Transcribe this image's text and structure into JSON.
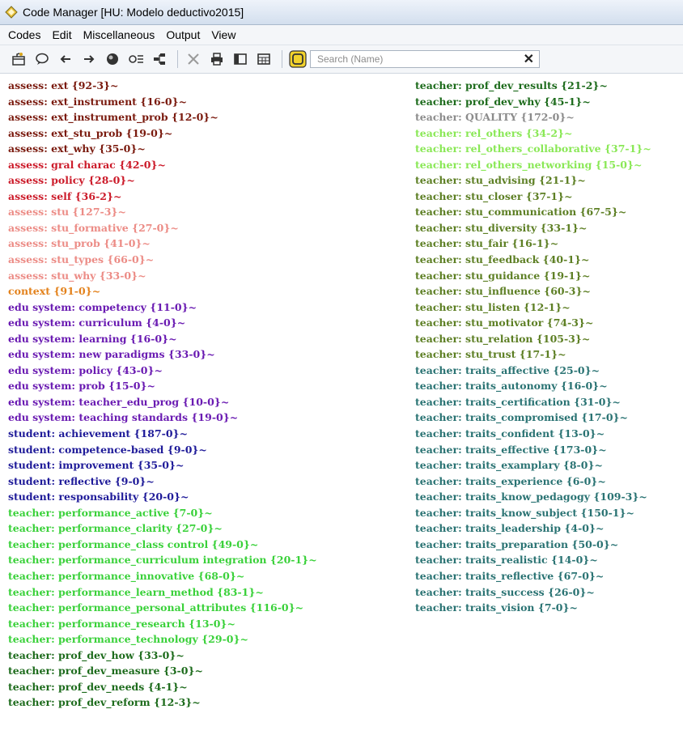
{
  "window": {
    "title": "Code Manager [HU: Modelo deductivo2015]"
  },
  "menu": [
    "Codes",
    "Edit",
    "Miscellaneous",
    "Output",
    "View"
  ],
  "toolbar": {
    "icons": [
      "new-code-icon",
      "comment-icon",
      "arrow-left-icon",
      "arrow-right-icon",
      "circle-icon",
      "filter-icon",
      "tree-icon",
      "delete-icon",
      "print-icon",
      "single-pane-icon",
      "table-icon"
    ],
    "search": {
      "placeholder": "Search (Name)",
      "value": ""
    },
    "clear_label": "✕"
  },
  "colors": {
    "assess_ext": "#7a1a0e",
    "assess_red": "#cc1b2a",
    "assess_pink": "#ec8c86",
    "context": "#e3821c",
    "edu_system": "#6a1bb2",
    "student": "#1f1b99",
    "teacher_perf": "#3ad13a",
    "teacher_prof": "#1d6b1c",
    "teacher_quality": "#8c8c8c",
    "teacher_rel": "#8ae856",
    "teacher_stu": "#5d7f24",
    "teacher_traits": "#2a7373"
  },
  "codes_left": [
    {
      "label": "assess: ext {92-3}~",
      "color": "#7a1a0e"
    },
    {
      "label": "assess: ext_instrument {16-0}~",
      "color": "#7a1a0e"
    },
    {
      "label": "assess: ext_instrument_prob {12-0}~",
      "color": "#7a1a0e"
    },
    {
      "label": "assess: ext_stu_prob {19-0}~",
      "color": "#7a1a0e"
    },
    {
      "label": "assess: ext_why {35-0}~",
      "color": "#7a1a0e"
    },
    {
      "label": "assess: gral charac {42-0}~",
      "color": "#cc1b2a"
    },
    {
      "label": "assess: policy {28-0}~",
      "color": "#cc1b2a"
    },
    {
      "label": "assess: self {36-2}~",
      "color": "#cc1b2a"
    },
    {
      "label": "assess: stu {127-3}~",
      "color": "#ec8c86"
    },
    {
      "label": "assess: stu_formative {27-0}~",
      "color": "#ec8c86"
    },
    {
      "label": "assess: stu_prob {41-0}~",
      "color": "#ec8c86"
    },
    {
      "label": "assess: stu_types {66-0}~",
      "color": "#ec8c86"
    },
    {
      "label": "assess: stu_why {33-0}~",
      "color": "#ec8c86"
    },
    {
      "label": "context {91-0}~",
      "color": "#e3821c"
    },
    {
      "label": "edu system: competency {11-0}~",
      "color": "#6a1bb2"
    },
    {
      "label": "edu system: curriculum {4-0}~",
      "color": "#6a1bb2"
    },
    {
      "label": "edu system: learning {16-0}~",
      "color": "#6a1bb2"
    },
    {
      "label": "edu system: new paradigms {33-0}~",
      "color": "#6a1bb2"
    },
    {
      "label": "edu system: policy {43-0}~",
      "color": "#6a1bb2"
    },
    {
      "label": "edu system: prob {15-0}~",
      "color": "#6a1bb2"
    },
    {
      "label": "edu system: teacher_edu_prog {10-0}~",
      "color": "#6a1bb2"
    },
    {
      "label": "edu system: teaching standards {19-0}~",
      "color": "#6a1bb2"
    },
    {
      "label": "student: achievement {187-0}~",
      "color": "#1f1b99"
    },
    {
      "label": "student: competence-based {9-0}~",
      "color": "#1f1b99"
    },
    {
      "label": "student: improvement {35-0}~",
      "color": "#1f1b99"
    },
    {
      "label": "student: reflective {9-0}~",
      "color": "#1f1b99"
    },
    {
      "label": "student: responsability {20-0}~",
      "color": "#1f1b99"
    },
    {
      "label": "teacher: performance_active {7-0}~",
      "color": "#3ad13a"
    },
    {
      "label": "teacher: performance_clarity {27-0}~",
      "color": "#3ad13a"
    },
    {
      "label": "teacher: performance_class control {49-0}~",
      "color": "#3ad13a"
    },
    {
      "label": "teacher: performance_curriculum integration {20-1}~",
      "color": "#3ad13a"
    },
    {
      "label": "teacher: performance_innovative {68-0}~",
      "color": "#3ad13a"
    },
    {
      "label": "teacher: performance_learn_method {83-1}~",
      "color": "#3ad13a"
    },
    {
      "label": "teacher: performance_personal_attributes {116-0}~",
      "color": "#3ad13a"
    },
    {
      "label": "teacher: performance_research {13-0}~",
      "color": "#3ad13a"
    },
    {
      "label": "teacher: performance_technology {29-0}~",
      "color": "#3ad13a"
    },
    {
      "label": "teacher: prof_dev_how {33-0}~",
      "color": "#1d6b1c"
    },
    {
      "label": "teacher: prof_dev_measure {3-0}~",
      "color": "#1d6b1c"
    },
    {
      "label": "teacher: prof_dev_needs {4-1}~",
      "color": "#1d6b1c"
    },
    {
      "label": "teacher: prof_dev_reform {12-3}~",
      "color": "#1d6b1c"
    }
  ],
  "codes_right": [
    {
      "label": "teacher: prof_dev_results {21-2}~",
      "color": "#1d6b1c"
    },
    {
      "label": "teacher: prof_dev_why {45-1}~",
      "color": "#1d6b1c"
    },
    {
      "label": "teacher: QUALITY {172-0}~",
      "color": "#8c8c8c"
    },
    {
      "label": "teacher: rel_others {34-2}~",
      "color": "#8ae856"
    },
    {
      "label": "teacher: rel_others_collaborative {37-1}~",
      "color": "#8ae856"
    },
    {
      "label": "teacher: rel_others_networking {15-0}~",
      "color": "#8ae856"
    },
    {
      "label": "teacher: stu_advising {21-1}~",
      "color": "#5d7f24"
    },
    {
      "label": "teacher: stu_closer {37-1}~",
      "color": "#5d7f24"
    },
    {
      "label": "teacher: stu_communication {67-5}~",
      "color": "#5d7f24"
    },
    {
      "label": "teacher: stu_diversity {33-1}~",
      "color": "#5d7f24"
    },
    {
      "label": "teacher: stu_fair {16-1}~",
      "color": "#5d7f24"
    },
    {
      "label": "teacher: stu_feedback {40-1}~",
      "color": "#5d7f24"
    },
    {
      "label": "teacher: stu_guidance {19-1}~",
      "color": "#5d7f24"
    },
    {
      "label": "teacher: stu_influence {60-3}~",
      "color": "#5d7f24"
    },
    {
      "label": "teacher: stu_listen {12-1}~",
      "color": "#5d7f24"
    },
    {
      "label": "teacher: stu_motivator {74-3}~",
      "color": "#5d7f24"
    },
    {
      "label": "teacher: stu_relation {105-3}~",
      "color": "#5d7f24"
    },
    {
      "label": "teacher: stu_trust {17-1}~",
      "color": "#5d7f24"
    },
    {
      "label": "teacher: traits_affective {25-0}~",
      "color": "#2a7373"
    },
    {
      "label": "teacher: traits_autonomy {16-0}~",
      "color": "#2a7373"
    },
    {
      "label": "teacher: traits_certification {31-0}~",
      "color": "#2a7373"
    },
    {
      "label": "teacher: traits_compromised {17-0}~",
      "color": "#2a7373"
    },
    {
      "label": "teacher: traits_confident {13-0}~",
      "color": "#2a7373"
    },
    {
      "label": "teacher: traits_effective {173-0}~",
      "color": "#2a7373"
    },
    {
      "label": "teacher: traits_examplary {8-0}~",
      "color": "#2a7373"
    },
    {
      "label": "teacher: traits_experience {6-0}~",
      "color": "#2a7373"
    },
    {
      "label": "teacher: traits_know_pedagogy {109-3}~",
      "color": "#2a7373"
    },
    {
      "label": "teacher: traits_know_subject {150-1}~",
      "color": "#2a7373"
    },
    {
      "label": "teacher: traits_leadership {4-0}~",
      "color": "#2a7373"
    },
    {
      "label": "teacher: traits_preparation {50-0}~",
      "color": "#2a7373"
    },
    {
      "label": "teacher: traits_realistic {14-0}~",
      "color": "#2a7373"
    },
    {
      "label": "teacher: traits_reflective {67-0}~",
      "color": "#2a7373"
    },
    {
      "label": "teacher: traits_success {26-0}~",
      "color": "#2a7373"
    },
    {
      "label": "teacher: traits_vision {7-0}~",
      "color": "#2a7373"
    }
  ]
}
